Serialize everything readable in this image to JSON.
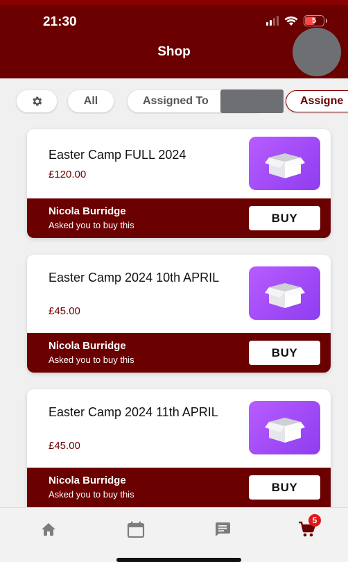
{
  "status_bar": {
    "time": "21:30",
    "battery": "5"
  },
  "header": {
    "title": "Shop"
  },
  "filters": {
    "all": "All",
    "assigned_to": "Assigned To",
    "assigned": "Assigne"
  },
  "items": [
    {
      "title": "Easter Camp FULL 2024",
      "price": "£120.00",
      "requester": "Nicola Burridge",
      "note": "Asked you to buy this",
      "buy": "BUY"
    },
    {
      "title": "Easter Camp 2024 10th APRIL",
      "price": "£45.00",
      "requester": "Nicola Burridge",
      "note": "Asked you to buy this",
      "buy": "BUY"
    },
    {
      "title": "Easter Camp 2024 11th APRIL",
      "price": "£45.00",
      "requester": "Nicola Burridge",
      "note": "Asked you to buy this",
      "buy": "BUY"
    }
  ],
  "tabbar": {
    "cart_badge": "5"
  },
  "colors": {
    "brand": "#6b0000",
    "accent": "#a855f7",
    "badge": "#e01818",
    "background": "#f0f0f0"
  },
  "icons": [
    "gear-icon",
    "box-icon",
    "home-icon",
    "calendar-icon",
    "chat-icon",
    "cart-icon",
    "wifi-icon",
    "signal-icon",
    "battery-icon"
  ]
}
